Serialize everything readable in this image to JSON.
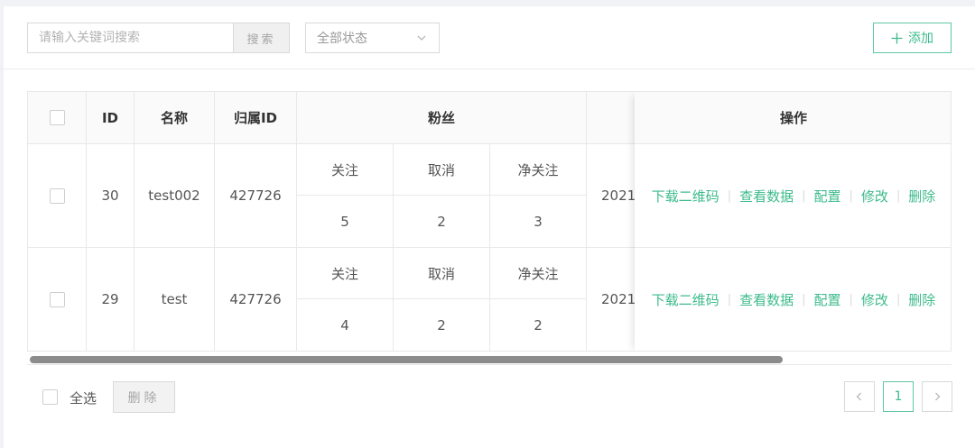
{
  "toolbar": {
    "search_placeholder": "请输入关键词搜索",
    "search_button": "搜索",
    "status_select": "全部状态",
    "add_button": "添加"
  },
  "table": {
    "headers": {
      "id": "ID",
      "name": "名称",
      "owner_id": "归属ID",
      "fans": "粉丝",
      "date_partial": "",
      "actions": "操作"
    },
    "fans_sub": [
      "关注",
      "取消",
      "净关注"
    ],
    "rows": [
      {
        "id": "30",
        "name": "test002",
        "owner_id": "427726",
        "follow": "5",
        "unfollow": "2",
        "net_follow": "3",
        "date_partial": "2021"
      },
      {
        "id": "29",
        "name": "test",
        "owner_id": "427726",
        "follow": "4",
        "unfollow": "2",
        "net_follow": "2",
        "date_partial": "2021"
      }
    ],
    "actions": [
      "下载二维码",
      "查看数据",
      "配置",
      "修改",
      "删除"
    ]
  },
  "footer": {
    "select_all": "全选",
    "delete_button": "删除",
    "current_page": "1"
  },
  "colors": {
    "accent": "#3dbb8c",
    "border": "#e8e8e8",
    "header_bg": "#fafafa"
  }
}
